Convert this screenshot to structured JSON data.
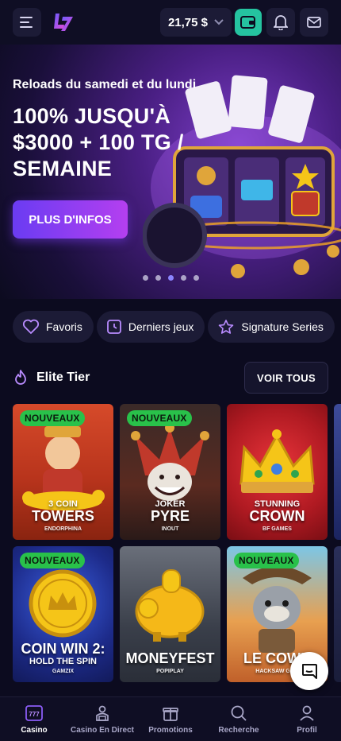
{
  "header": {
    "balance": "21,75 $",
    "icons": [
      "menu-icon",
      "brand-logo",
      "chevron-down-icon",
      "wallet-icon",
      "bell-icon",
      "mail-icon"
    ]
  },
  "banner": {
    "subtitle": "Reloads du samedi et du lundi",
    "title": "100% JUSQU'À $3000 + 100 TG / SEMAINE",
    "cta": "PLUS D'INFOS",
    "slide_count": 5,
    "active_slide": 3
  },
  "chips": [
    {
      "label": "Favoris",
      "icon": "heart-icon"
    },
    {
      "label": "Derniers jeux",
      "icon": "clock-icon"
    },
    {
      "label": "Signature Series",
      "icon": "star-icon"
    }
  ],
  "section": {
    "title": "Elite Tier",
    "icon": "flame-icon",
    "see_all": "VOIR TOUS"
  },
  "games": [
    {
      "badge": "NOUVEAUX",
      "small": "3 COIN",
      "big": "TOWERS",
      "provider": "ENDORPHINA"
    },
    {
      "badge": "NOUVEAUX",
      "small": "JOKER",
      "big": "PYRE",
      "provider": "INOUT"
    },
    {
      "badge": "",
      "small": "STUNNING",
      "big": "CROWN",
      "provider": "BF GAMES"
    },
    {
      "badge": "NOUVEAUX",
      "small": "",
      "big": "COIN WIN 2:",
      "big2": "HOLD THE SPIN",
      "provider": "GAMZIX"
    },
    {
      "badge": "",
      "small": "",
      "big": "MONEYFEST",
      "provider": "POPIPLAY"
    },
    {
      "badge": "NOUVEAUX",
      "small": "",
      "big": "LE COWB",
      "provider": "HACKSAW GAM"
    }
  ],
  "nav": [
    {
      "label": "Casino",
      "icon": "slot-777-icon",
      "active": true
    },
    {
      "label": "Casino En Direct",
      "icon": "dealer-icon",
      "active": false
    },
    {
      "label": "Promotions",
      "icon": "gift-icon",
      "active": false
    },
    {
      "label": "Recherche",
      "icon": "search-icon",
      "active": false
    },
    {
      "label": "Profil",
      "icon": "user-icon",
      "active": false
    }
  ],
  "colors": {
    "background": "#0c0b1f",
    "accent": "#8b5cf6",
    "wallet": "#25c3a0",
    "badge": "#29c14a"
  }
}
